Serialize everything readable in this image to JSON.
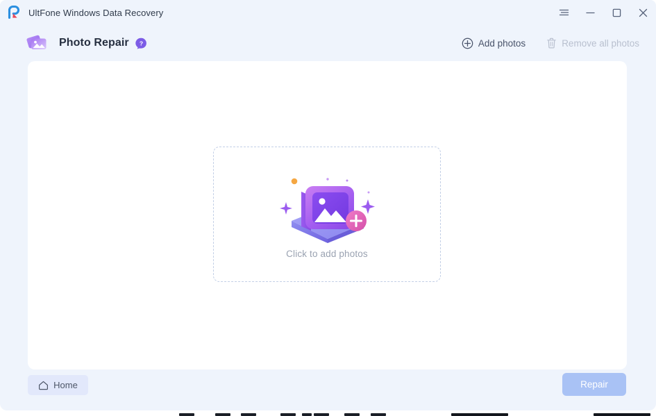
{
  "window": {
    "title": "UltFone Windows Data Recovery",
    "logo_icon": "ultfone-logo-icon",
    "controls": {
      "menu_icon": "hamburger-menu-icon",
      "minimize_icon": "minimize-icon",
      "maximize_icon": "maximize-icon",
      "close_icon": "close-icon"
    }
  },
  "module": {
    "icon": "photo-repair-icon",
    "title": "Photo Repair",
    "help_icon": "help-question-icon",
    "help_tooltip": "?"
  },
  "toolbar": {
    "add_photos": {
      "label": "Add photos",
      "icon": "plus-circle-icon",
      "enabled": true
    },
    "remove_all_photos": {
      "label": "Remove all photos",
      "icon": "trash-icon",
      "enabled": false
    }
  },
  "dropzone": {
    "label": "Click to add photos",
    "illustration": "add-photo-illustration",
    "border_style": "dashed"
  },
  "footer": {
    "home": {
      "label": "Home",
      "icon": "home-icon"
    },
    "repair": {
      "label": "Repair",
      "enabled": false
    }
  },
  "colors": {
    "page_background": "#eff4fc",
    "card_background": "#ffffff",
    "accent_purple": "#8b5cf6",
    "accent_pink": "#e863b0",
    "accent_orange": "#f5a742",
    "primary_button": "#a9c2f5",
    "dashed_border": "#c2cfe6",
    "title_text": "#262f40",
    "muted_text": "#9aa2b1",
    "disabled_text": "#b9c0cf",
    "logo_blue": "#2b8fe0",
    "logo_red": "#e8475a"
  }
}
